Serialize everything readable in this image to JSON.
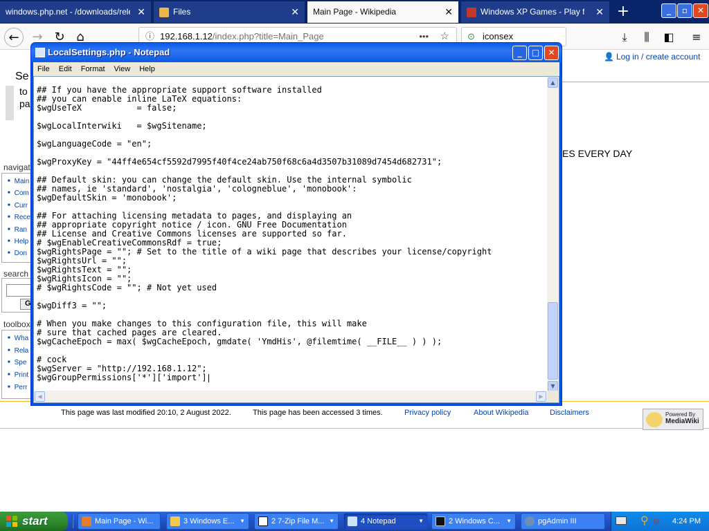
{
  "browser": {
    "tabs": [
      {
        "label": "windows.php.net - /downloads/releas",
        "active": false
      },
      {
        "label": "Files",
        "active": false
      },
      {
        "label": "Main Page - Wikipedia",
        "active": true
      },
      {
        "label": "Windows XP Games - Play for Fre",
        "active": false
      }
    ],
    "new_tab": "+",
    "url_host": "192.168.1.12",
    "url_path": "/index.php?title=Main_Page",
    "url_menu": "•••",
    "search_value": "iconsex"
  },
  "wiki": {
    "account_link": "Log in / create account",
    "partial_heading_left": "Se",
    "partial_text_1": "to",
    "partial_text_2": "pa",
    "every_day_text": "ES EVERY DAY",
    "navigation_header": "navigat",
    "navigation_items": [
      "Main",
      "Com",
      "Curr",
      "Rece",
      "Ran",
      "Help",
      "Don"
    ],
    "search_header": "search",
    "search_go": "G",
    "toolbox_header": "toolbox",
    "toolbox_items": [
      "Wha",
      "Rela",
      "Spe",
      "Print",
      "Perr"
    ],
    "footer": {
      "last_modified": "This page was last modified 20:10, 2 August 2022.",
      "accessed": "This page has been accessed 3 times.",
      "privacy": "Privacy policy",
      "about": "About Wikipedia",
      "disclaimers": "Disclaimers",
      "badge_line1": "Powered By",
      "badge_line2": "MediaWiki"
    }
  },
  "notepad": {
    "title": "LocalSettings.php - Notepad",
    "menu": [
      "File",
      "Edit",
      "Format",
      "View",
      "Help"
    ],
    "lines": [
      "## If you have the appropriate support software installed",
      "## you can enable inline LaTeX equations:",
      "$wgUseTeX           = false;",
      "",
      "$wgLocalInterwiki   = $wgSitename;",
      "",
      "$wgLanguageCode = \"en\";",
      "",
      "$wgProxyKey = \"44ff4e654cf5592d7995f40f4ce24ab750f68c6a4d3507b31089d7454d682731\";",
      "",
      "## Default skin: you can change the default skin. Use the internal symbolic",
      "## names, ie 'standard', 'nostalgia', 'cologneblue', 'monobook':",
      "$wgDefaultSkin = 'monobook';",
      "",
      "## For attaching licensing metadata to pages, and displaying an",
      "## appropriate copyright notice / icon. GNU Free Documentation",
      "## License and Creative Commons licenses are supported so far.",
      "# $wgEnableCreativeCommonsRdf = true;",
      "$wgRightsPage = \"\"; # Set to the title of a wiki page that describes your license/copyright",
      "$wgRightsUrl = \"\";",
      "$wgRightsText = \"\";",
      "$wgRightsIcon = \"\";",
      "# $wgRightsCode = \"\"; # Not yet used",
      "",
      "$wgDiff3 = \"\";",
      "",
      "# When you make changes to this configuration file, this will make",
      "# sure that cached pages are cleared.",
      "$wgCacheEpoch = max( $wgCacheEpoch, gmdate( 'YmdHis', @filemtime( __FILE__ ) ) );",
      "",
      "# cock",
      "$wgServer = \"http://192.168.1.12\";",
      "$wgGroupPermissions['*']['import']"
    ]
  },
  "taskbar": {
    "start_label": "start",
    "tasks": [
      {
        "label": "Main Page - Wi...",
        "active": false
      },
      {
        "label": "3 Windows E...",
        "active": false
      },
      {
        "label": "2 7-Zip File M...",
        "active": false
      },
      {
        "label": "4 Notepad",
        "active": true
      },
      {
        "label": "2 Windows C...",
        "active": false
      },
      {
        "label": "pgAdmin III",
        "active": false
      }
    ],
    "clock": "4:24 PM"
  },
  "colors": {
    "xp_blue": "#0054e3",
    "start_green": "#2e8b2e",
    "wiki_link": "#0645ad"
  }
}
